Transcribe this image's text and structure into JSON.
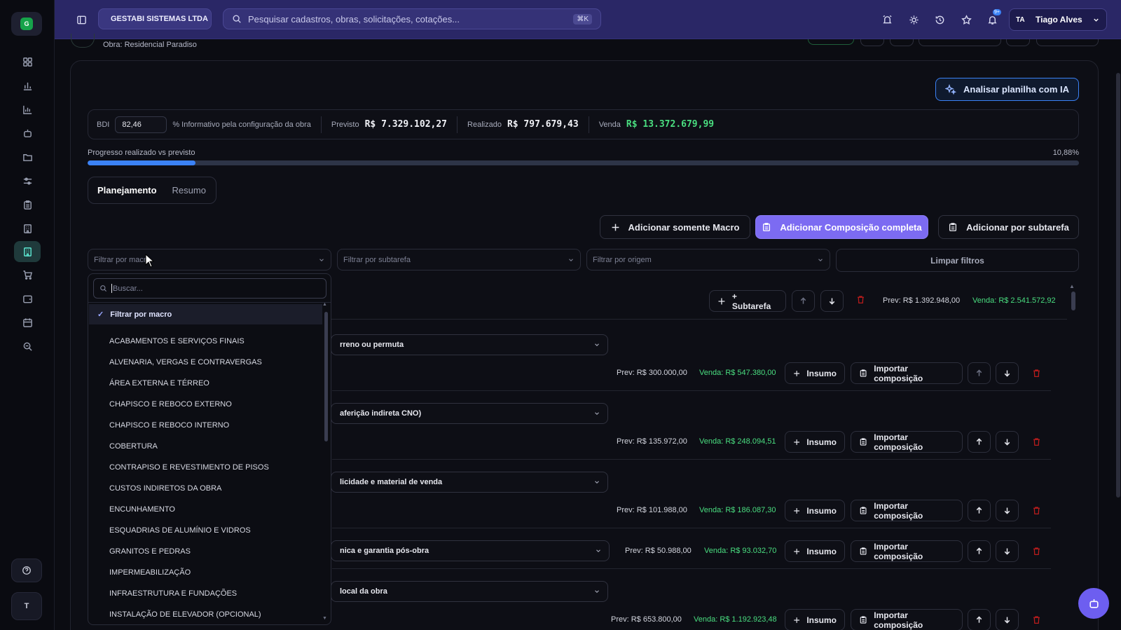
{
  "sidebar": {
    "logo_letter": "G",
    "items": [
      "dashboard-icon",
      "bar-chart-icon",
      "bar-chart-2-icon",
      "bot-icon",
      "folder-icon",
      "sliders-icon",
      "clipboard-icon",
      "building-icon",
      "building-active-icon",
      "cart-icon",
      "wallet-icon",
      "calendar-icon",
      "search-zoom-icon"
    ],
    "avatar_letter": "T"
  },
  "topbar": {
    "company": "GESTABI SISTEMAS LTDA",
    "search_placeholder": "Pesquisar cadastros, obras, solicitações, cotações...",
    "search_shortcut": "⌘K",
    "notif_badge": "9+",
    "user_initials": "TA",
    "user_name": "Tiago Alves"
  },
  "page": {
    "obra_label": "Obra: Residencial Paradiso",
    "ai_button": "Analisar planilha com IA",
    "bdi_label": "BDI",
    "bdi_value": "82,46",
    "bdi_note": "% Informativo pela configuração da obra",
    "previsto_label": "Previsto",
    "previsto_value": "R$ 7.329.102,27",
    "realizado_label": "Realizado",
    "realizado_value": "R$ 797.679,43",
    "venda_label": "Venda",
    "venda_value": "R$ 13.372.679,99",
    "progress_label": "Progresso realizado vs previsto",
    "progress_pct": "10,88%",
    "progress_fraction": 0.1088,
    "tabs": [
      "Planejamento",
      "Resumo"
    ],
    "active_tab": "Planejamento",
    "actions": {
      "add_macro": "Adicionar somente Macro",
      "add_composition": "Adicionar Composição completa",
      "add_subtask": "Adicionar por subtarefa"
    },
    "filters": {
      "macro": "Filtrar por macro",
      "subtask": "Filtrar por subtarefa",
      "origin": "Filtrar por origem",
      "clear": "Limpar filtros"
    }
  },
  "macro_row": {
    "subtask_button": "+ Subtarefa",
    "prev": "Prev: R$ 1.392.948,00",
    "venda": "Venda: R$ 2.541.572,92"
  },
  "subtasks": [
    {
      "name": "rreno ou permuta",
      "prev": "Prev: R$ 300.000,00",
      "venda": "Venda: R$ 547.380,00"
    },
    {
      "name": "aferição indireta CNO)",
      "prev": "Prev: R$ 135.972,00",
      "venda": "Venda: R$ 248.094,51"
    },
    {
      "name": "licidade e material de venda",
      "prev": "Prev: R$ 101.988,00",
      "venda": "Venda: R$ 186.087,30"
    },
    {
      "name": "nica e garantia pós-obra",
      "prev": "Prev: R$ 50.988,00",
      "venda": "Venda: R$ 93.032,70"
    },
    {
      "name": "local da obra",
      "prev": "Prev: R$ 653.800,00",
      "venda": "Venda: R$ 1.192.923,48"
    }
  ],
  "row_buttons": {
    "insumo": "Insumo",
    "import": "Importar composição"
  },
  "dropdown": {
    "search_placeholder": "Buscar...",
    "selected": "Filtrar por macro",
    "options": [
      "ACABAMENTOS E SERVIÇOS FINAIS",
      "ALVENARIA, VERGAS E CONTRAVERGAS",
      "ÁREA EXTERNA E TÉRREO",
      "CHAPISCO E REBOCO EXTERNO",
      "CHAPISCO E REBOCO INTERNO",
      "COBERTURA",
      "CONTRAPISO E REVESTIMENTO DE PISOS",
      "CUSTOS INDIRETOS DA OBRA",
      "ENCUNHAMENTO",
      "ESQUADRIAS DE ALUMÍNIO E VIDROS",
      "GRANITOS E PEDRAS",
      "IMPERMEABILIZAÇÃO",
      "INFRAESTRUTURA E FUNDAÇÕES",
      "INSTALAÇÃO DE ELEVADOR (OPCIONAL)"
    ]
  },
  "colors": {
    "accent": "#7c6bf2",
    "topbar": "#2a2766",
    "green": "#4ade80",
    "blue": "#3b82f6",
    "danger": "#b91c1c"
  }
}
